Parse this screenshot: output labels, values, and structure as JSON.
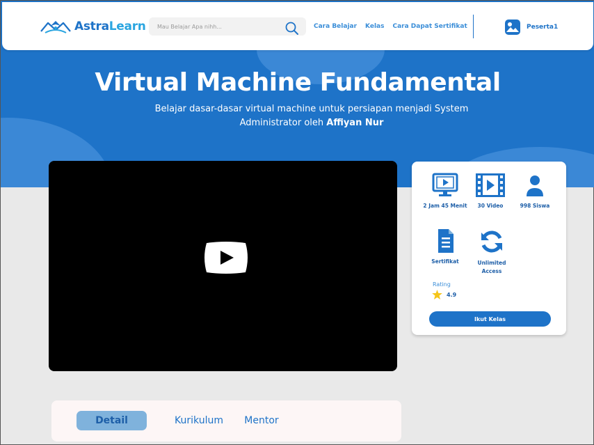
{
  "brand": {
    "name_part1": "Astra",
    "name_part2": "Learn"
  },
  "search": {
    "placeholder": "Mau Belajar Apa nihh..."
  },
  "nav": {
    "links": [
      "Cara Belajar",
      "Kelas",
      "Cara Dapat Sertifikat"
    ]
  },
  "user": {
    "name": "Peserta1"
  },
  "course": {
    "title": "Virtual Machine Fundamental",
    "subtitle_line1": "Belajar dasar-dasar virtual machine untuk persiapan menjadi System",
    "subtitle_line2": "Administrator oleh ",
    "author": "Affiyan Nur"
  },
  "stats": {
    "duration": "2 Jam 45 Menit",
    "videos": "30 Video",
    "students": "998  Siswa",
    "certificate": "Sertifikat",
    "access_line1": "Unlimited",
    "access_line2": "Access"
  },
  "rating": {
    "label": "Rating",
    "value": "4.9"
  },
  "cta": {
    "join_label": "Ikut Kelas"
  },
  "tabs": [
    {
      "label": "Detail",
      "active": true
    },
    {
      "label": "Kurikulum",
      "active": false
    },
    {
      "label": "Mentor",
      "active": false
    }
  ],
  "colors": {
    "primary": "#1e73c8",
    "accent": "#2aa5e0",
    "star": "#f5c518",
    "tab_active": "#7fb2dc"
  }
}
